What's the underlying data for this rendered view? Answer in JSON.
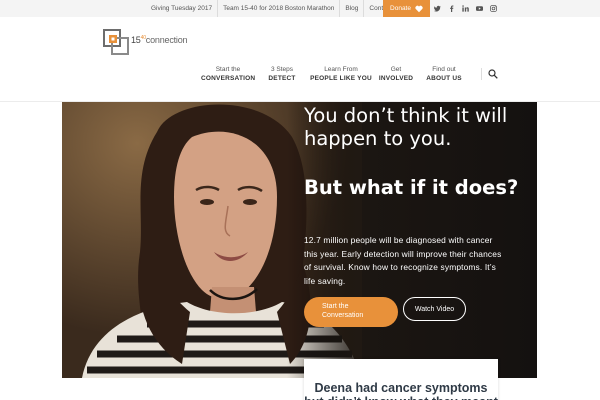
{
  "topbar": {
    "links": [
      "Giving Tuesday 2017",
      "Team 15-40 for 2018 Boston Marathon",
      "Blog",
      "Contact"
    ],
    "donate_label": "Donate",
    "social": [
      "twitter-icon",
      "facebook-icon",
      "linkedin-icon",
      "youtube-icon",
      "instagram-icon"
    ]
  },
  "brand": {
    "logo_prefix": "15",
    "logo_mid": "40",
    "logo_suffix": "connection",
    "accent": "#e8913a",
    "dark": "#2f3a46"
  },
  "nav": {
    "items": [
      {
        "line1": "Start the",
        "line2": "CONVERSATION"
      },
      {
        "line1": "3 Steps",
        "line2": "DETECT"
      },
      {
        "line1": "Learn From",
        "line2": "PEOPLE LIKE YOU"
      },
      {
        "line1": "Get",
        "line2": "INVOLVED"
      },
      {
        "line1": "Find out",
        "line2": "ABOUT US"
      }
    ]
  },
  "hero": {
    "headline": "You don’t think it will happen to you.",
    "headline_bold": "But what if it does?",
    "lede": "12.7 million people will be diagnosed with cancer this year. Early detection will improve their chances of survival. Know how to recognize symptoms. It’s life saving.",
    "primary_line1": "Start the",
    "primary_line2": "Conversation",
    "secondary": "Watch Video"
  },
  "story": {
    "title": "Deena had cancer symptoms but didn’t know what they meant"
  }
}
